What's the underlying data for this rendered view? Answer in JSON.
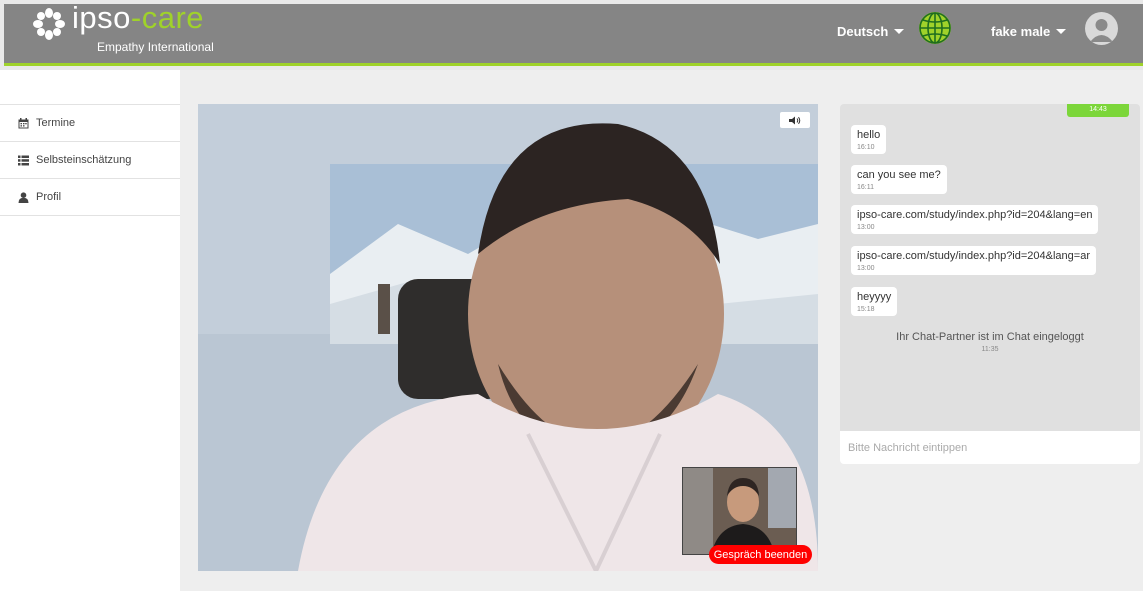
{
  "header": {
    "logo_ipso": "ipso",
    "logo_care": "-care",
    "logo_subtitle": "Empathy International",
    "language_label": "Deutsch",
    "user_label": "fake male",
    "accent_color": "#9fd22a"
  },
  "sidebar": {
    "items": [
      {
        "label": "Termine",
        "icon": "calendar-icon"
      },
      {
        "label": "Selbsteinschätzung",
        "icon": "list-icon"
      },
      {
        "label": "Profil",
        "icon": "user-icon"
      }
    ]
  },
  "video": {
    "end_call_label": "Gespräch beenden",
    "volume_icon": "speaker-icon",
    "end_call_color": "#ff0000"
  },
  "chat": {
    "own_time": "14:43",
    "messages": [
      {
        "text": "hello",
        "time": "16:10"
      },
      {
        "text": "can you see me?",
        "time": "16:11"
      },
      {
        "text": "ipso-care.com/study/index.php?id=204&lang=en",
        "time": "13:00"
      },
      {
        "text": "ipso-care.com/study/index.php?id=204&lang=ar",
        "time": "13:00"
      },
      {
        "text": "heyyyy",
        "time": "15:18"
      }
    ],
    "system_message": {
      "text": "Ihr Chat-Partner ist im Chat eingeloggt",
      "time": "11:35"
    },
    "input_placeholder": "Bitte Nachricht eintippen"
  }
}
